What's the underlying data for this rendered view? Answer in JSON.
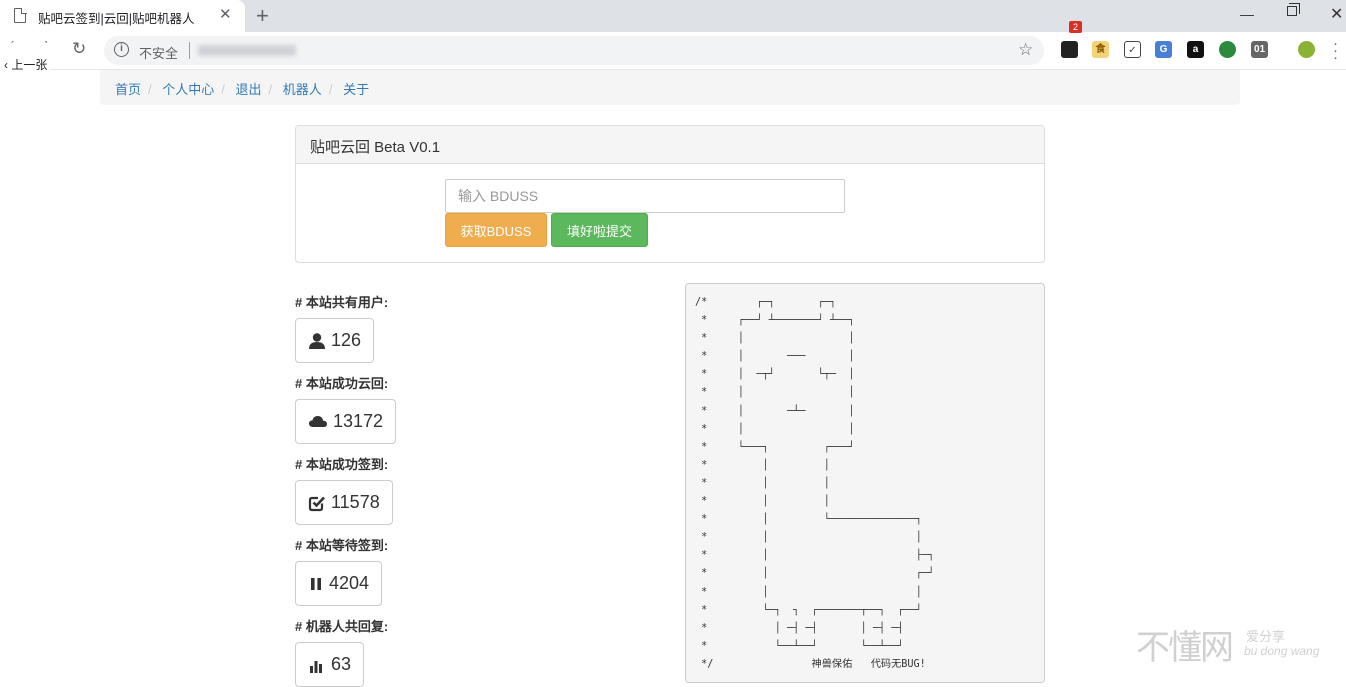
{
  "browser": {
    "tab_title": "贴吧云签到|云回|贴吧机器人",
    "tab_close": "✕",
    "new_tab": "+",
    "insecure_label": "不安全",
    "prev_tip": "上一张",
    "extension_badge": "2"
  },
  "breadcrumb": {
    "items": [
      "首页",
      "个人中心",
      "退出",
      "机器人",
      "关于"
    ],
    "separator": "/"
  },
  "panel": {
    "title": "贴吧云回 Beta V0.1",
    "input_placeholder": "输入 BDUSS",
    "get_button": "获取BDUSS",
    "submit_button": "填好啦提交"
  },
  "stats": [
    {
      "label": "# 本站共有用户:",
      "value": "126",
      "icon": "user-icon"
    },
    {
      "label": "# 本站成功云回:",
      "value": "13172",
      "icon": "cloud-icon"
    },
    {
      "label": "# 本站成功签到:",
      "value": "11578",
      "icon": "check-square-icon"
    },
    {
      "label": "# 本站等待签到:",
      "value": "4204",
      "icon": "pause-icon"
    },
    {
      "label": "# 机器人共回复:",
      "value": "63",
      "icon": "bar-chart-icon"
    }
  ],
  "ascii_art": {
    "caption": "神兽保佑   代码无BUG!"
  },
  "watermark": {
    "main": "不懂网",
    "sub1": "爱分享",
    "sub2": "bu dong wang"
  }
}
